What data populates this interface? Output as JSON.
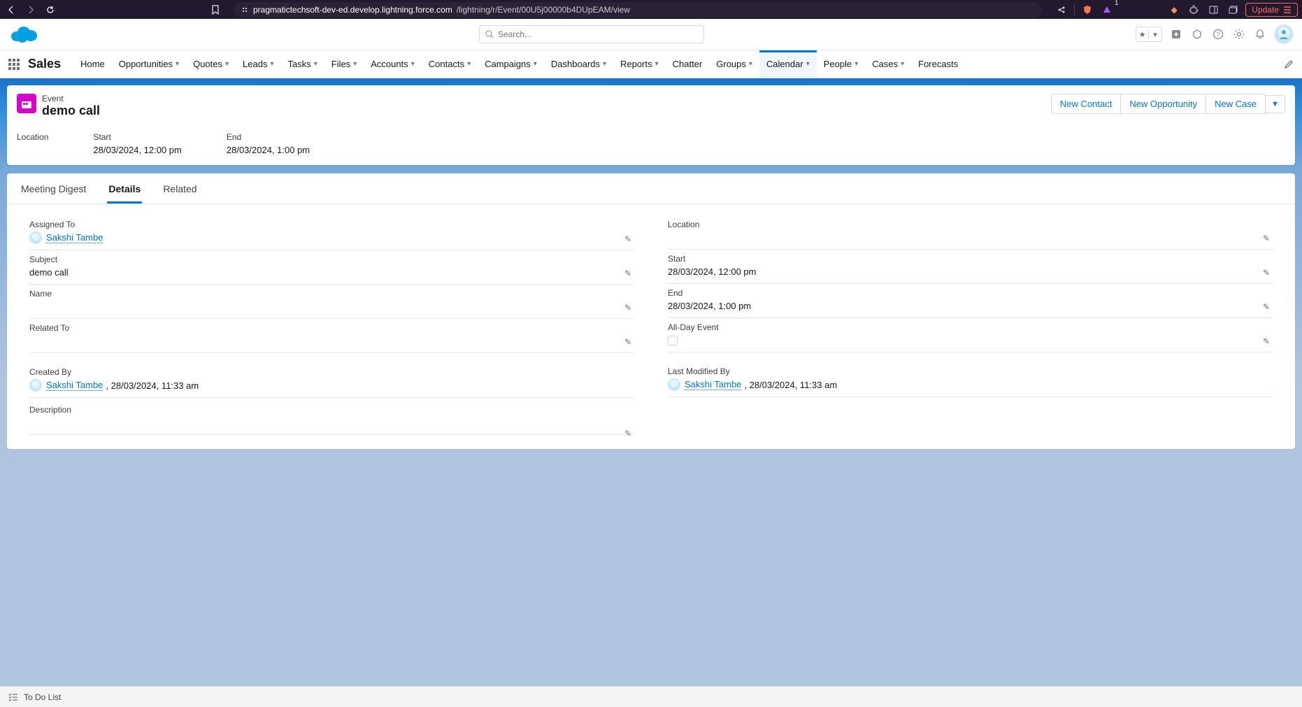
{
  "browser": {
    "url_host": "pragmatictechsoft-dev-ed.develop.lightning.force.com",
    "url_path": "/lightning/r/Event/00U5j00000b4DUpEAM/view",
    "update_label": "Update",
    "warn_badge": "1"
  },
  "header": {
    "search_placeholder": "Search..."
  },
  "app": {
    "name": "Sales"
  },
  "nav": {
    "home": "Home",
    "opportunities": "Opportunities",
    "quotes": "Quotes",
    "leads": "Leads",
    "tasks": "Tasks",
    "files": "Files",
    "accounts": "Accounts",
    "contacts": "Contacts",
    "campaigns": "Campaigns",
    "dashboards": "Dashboards",
    "reports": "Reports",
    "chatter": "Chatter",
    "groups": "Groups",
    "calendar": "Calendar",
    "people": "People",
    "cases": "Cases",
    "forecasts": "Forecasts"
  },
  "record": {
    "type": "Event",
    "title": "demo call",
    "actions": {
      "new_contact": "New Contact",
      "new_opportunity": "New Opportunity",
      "new_case": "New Case"
    },
    "summary": {
      "location_label": "Location",
      "location_value": "",
      "start_label": "Start",
      "start_value": "28/03/2024, 12:00 pm",
      "end_label": "End",
      "end_value": "28/03/2024, 1:00 pm"
    }
  },
  "tabs": {
    "meeting_digest": "Meeting Digest",
    "details": "Details",
    "related": "Related"
  },
  "details": {
    "assigned_to": {
      "label": "Assigned To",
      "user": "Sakshi Tambe"
    },
    "subject": {
      "label": "Subject",
      "value": "demo call"
    },
    "name": {
      "label": "Name",
      "value": ""
    },
    "related_to": {
      "label": "Related To",
      "value": ""
    },
    "created_by": {
      "label": "Created By",
      "user": "Sakshi Tambe",
      "ts": ", 28/03/2024, 11:33 am"
    },
    "description": {
      "label": "Description",
      "value": ""
    },
    "location": {
      "label": "Location",
      "value": ""
    },
    "start": {
      "label": "Start",
      "value": "28/03/2024, 12:00 pm"
    },
    "end": {
      "label": "End",
      "value": "28/03/2024, 1:00 pm"
    },
    "all_day": {
      "label": "All-Day Event"
    },
    "modified_by": {
      "label": "Last Modified By",
      "user": "Sakshi Tambe",
      "ts": ", 28/03/2024, 11:33 am"
    }
  },
  "footer": {
    "todo": "To Do List"
  }
}
